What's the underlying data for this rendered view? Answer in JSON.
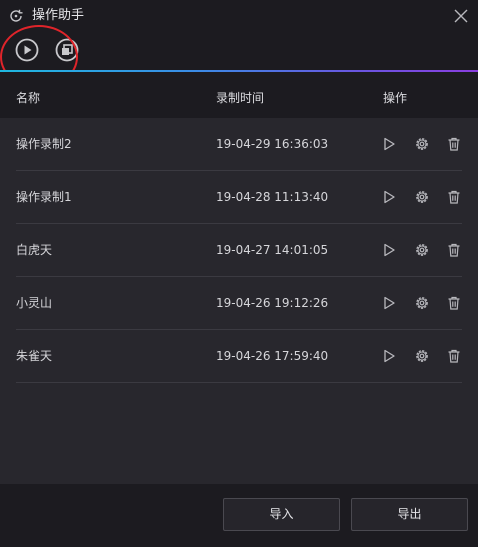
{
  "window": {
    "title": "操作助手",
    "title_icon": "refresh-icon",
    "close_icon": "close-icon"
  },
  "toolbar": {
    "play_icon": "play-circle-icon",
    "copy_icon": "copy-icon",
    "highlight_color": "#e0242a"
  },
  "table": {
    "headers": {
      "name": "名称",
      "time": "录制时间",
      "actions": "操作"
    },
    "rows": [
      {
        "name": "操作录制2",
        "time": "19-04-29 16:36:03"
      },
      {
        "name": "操作录制1",
        "time": "19-04-28 11:13:40"
      },
      {
        "name": "白虎天",
        "time": "19-04-27 14:01:05"
      },
      {
        "name": "小灵山",
        "time": "19-04-26 19:12:26"
      },
      {
        "name": "朱雀天",
        "time": "19-04-26 17:59:40"
      }
    ],
    "row_action_icons": [
      "play-icon",
      "gear-icon",
      "trash-icon"
    ]
  },
  "footer": {
    "import_label": "导入",
    "export_label": "导出"
  },
  "colors": {
    "background": "#1c1b20",
    "list_background": "#28272d",
    "accent_gradient_start": "#1fb8e0",
    "accent_gradient_end": "#8a3ee0"
  }
}
